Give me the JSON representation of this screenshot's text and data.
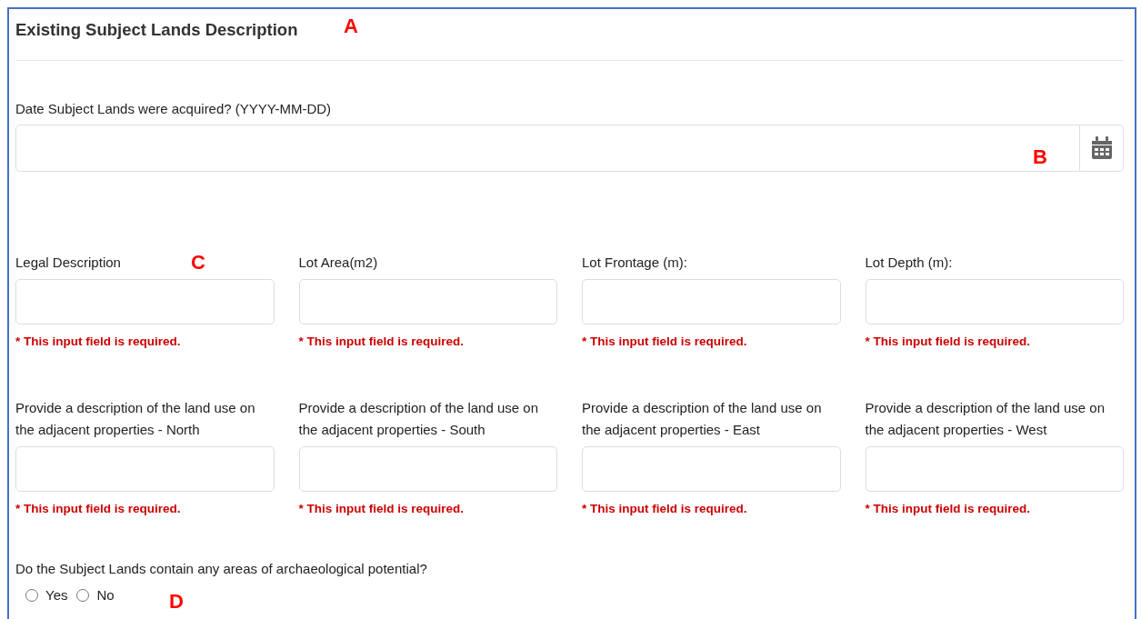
{
  "section": {
    "title": "Existing Subject Lands Description"
  },
  "date_field": {
    "label": "Date Subject Lands were acquired? (YYYY-MM-DD)"
  },
  "rows": [
    {
      "fields": [
        {
          "label": "Legal Description",
          "error": "* This input field is required."
        },
        {
          "label": "Lot Area(m2)",
          "error": "* This input field is required."
        },
        {
          "label": "Lot Frontage (m):",
          "error": "* This input field is required."
        },
        {
          "label": "Lot Depth (m):",
          "error": "* This input field is required."
        }
      ]
    },
    {
      "fields": [
        {
          "label": "Provide a description of the land use on the adjacent properties - North",
          "error": "* This input field is required."
        },
        {
          "label": "Provide a description of the land use on the adjacent properties - South",
          "error": "* This input field is required."
        },
        {
          "label": "Provide a description of the land use on the adjacent properties - East",
          "error": "* This input field is required."
        },
        {
          "label": "Provide a description of the land use on the adjacent properties - West",
          "error": "* This input field is required."
        }
      ]
    }
  ],
  "question": {
    "label": "Do the Subject Lands contain any areas of archaeological potential?",
    "options": [
      {
        "label": "Yes",
        "selected": false
      },
      {
        "label": "No",
        "selected": false
      }
    ]
  },
  "annotations": [
    {
      "label": "A"
    },
    {
      "label": "B"
    },
    {
      "label": "C"
    },
    {
      "label": "D"
    }
  ]
}
